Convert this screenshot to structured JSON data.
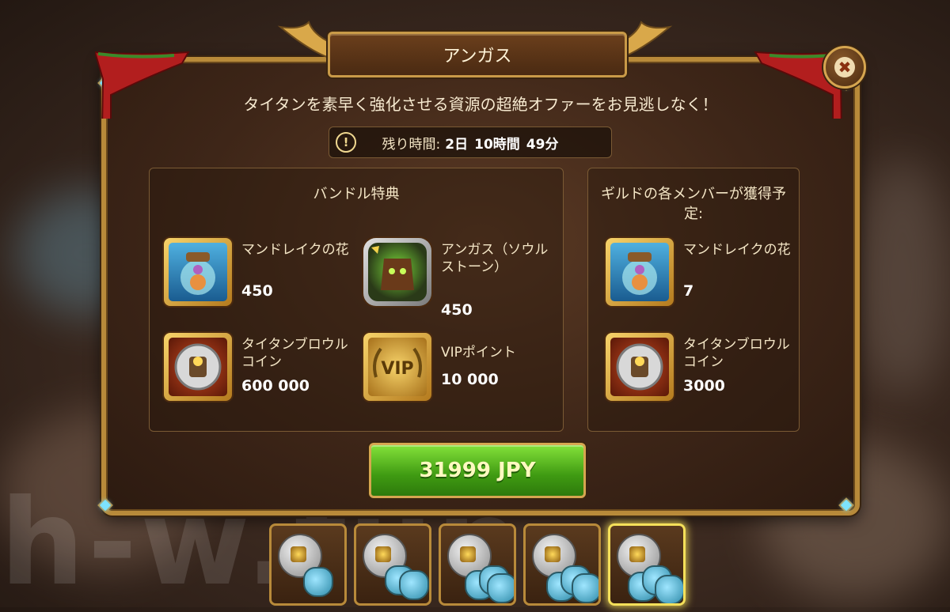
{
  "dialog": {
    "title": "アンガス",
    "subtitle": "タイタンを素早く強化させる資源の超絶オファーをお見逃しなく！",
    "timer": {
      "label": "残り時間:",
      "days": "2日",
      "hours": "10時間",
      "minutes": "49分"
    }
  },
  "bundle": {
    "title": "バンドル特典",
    "items": [
      {
        "label": "マンドレイクの花",
        "amount": "450",
        "icon": "mandrake-flower-jar-icon"
      },
      {
        "label": "アンガス（ソウルストーン）",
        "amount": "450",
        "icon": "angus-soulstone-icon"
      },
      {
        "label": "タイタンブロウルコイン",
        "amount": "600 000",
        "icon": "titan-brawl-coin-icon"
      },
      {
        "label": "VIPポイント",
        "amount": "10 000",
        "icon": "vip-points-icon"
      }
    ]
  },
  "guild": {
    "title": "ギルドの各メンバーが獲得予定:",
    "items": [
      {
        "label": "マンドレイクの花",
        "amount": "7",
        "icon": "mandrake-flower-jar-icon"
      },
      {
        "label": "タイタンブロウルコイン",
        "amount": "3000",
        "icon": "titan-brawl-coin-icon"
      }
    ]
  },
  "purchase": {
    "price": "31999 JPY"
  },
  "watermark": "h-w.fun",
  "colors": {
    "frame_gold": "#b88a3a",
    "buy_green": "#3f9a12",
    "gem_cyan": "#7de3ff",
    "active_tab": "#f4e05a"
  }
}
